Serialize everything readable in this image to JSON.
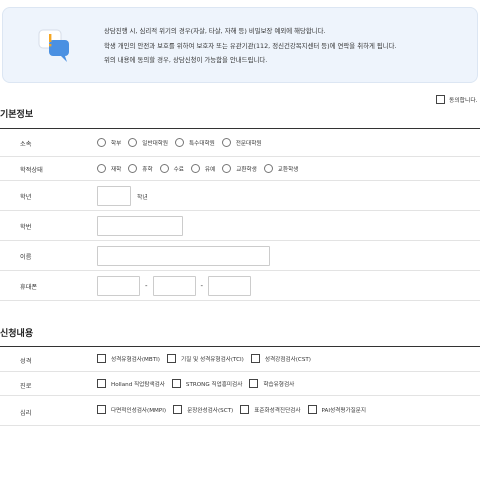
{
  "notice": {
    "lines": [
      "상담진행 시, 심리적 위기의 경우(자살, 타살, 자해 등) 비밀보장 예외에 해당합니다.",
      "학생 개인의 안전과 보호를 위하여 보호자 또는 유관기관(112, 정신건강복지센터 등)에 연락을 취하게 됩니다.",
      "위의 내용에 동의할 경우, 상담신청이 가능함을 안내드립니다."
    ],
    "icon": "chat-warning-icon",
    "accent": "#4a90e2",
    "warning_color": "#f5a623"
  },
  "agree": {
    "label": "동의합니다."
  },
  "basic": {
    "title": "기본정보",
    "affiliation": {
      "label": "소속",
      "options": [
        "학부",
        "일반대학원",
        "특수대학원",
        "전문대학원"
      ]
    },
    "status": {
      "label": "학적상태",
      "options": [
        "재학",
        "휴학",
        "수료",
        "유예",
        "교환학생",
        "교환학생"
      ]
    },
    "grade": {
      "label": "학년",
      "value": "",
      "unit": "학년"
    },
    "student_id": {
      "label": "학번",
      "value": ""
    },
    "name": {
      "label": "이름",
      "value": ""
    },
    "phone": {
      "label": "휴대폰",
      "part1": "",
      "part2": "",
      "part3": "",
      "separator": "-"
    }
  },
  "apply": {
    "title": "신청내용",
    "personality": {
      "label": "성격",
      "options": [
        "성격유형검사(MBTI)",
        "기질 및 성격유형검사(TCI)",
        "성격강점검사(CST)"
      ]
    },
    "career": {
      "label": "진로",
      "options": [
        "Holland 직업탐색검사",
        "STRONG 직업흥미검사",
        "학습유형검사"
      ]
    },
    "mental": {
      "label": "심리",
      "options": [
        "다면적인성검사(MMPI)",
        "문장완성검사(SCT)",
        "표준화성격진단검사",
        "PAI성격평가질문지"
      ]
    }
  }
}
